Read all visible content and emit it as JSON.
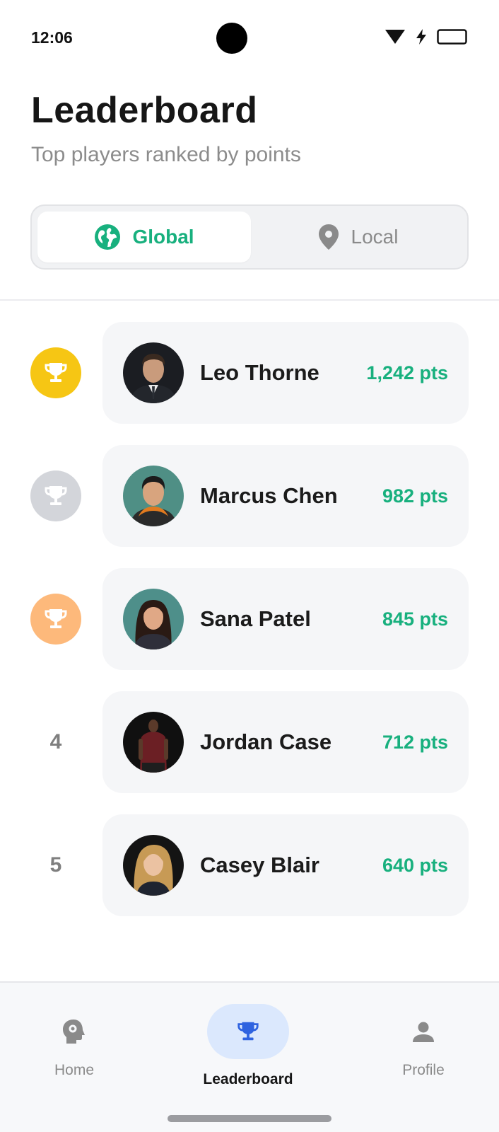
{
  "status_bar": {
    "time": "12:06"
  },
  "header": {
    "title": "Leaderboard",
    "subtitle": "Top players ranked by points"
  },
  "scope_toggle": {
    "options": [
      {
        "label": "Global",
        "icon": "globe-icon",
        "selected": true
      },
      {
        "label": "Local",
        "icon": "location-pin-icon",
        "selected": false
      }
    ]
  },
  "players": [
    {
      "rank": "1",
      "badge": "trophy-icon",
      "badge_color": "#f6c614",
      "name": "Leo Thorne",
      "points": "1,242 pts"
    },
    {
      "rank": "2",
      "badge": "trophy-icon",
      "badge_color": "#d3d5da",
      "name": "Marcus Chen",
      "points": "982 pts"
    },
    {
      "rank": "3",
      "badge": "trophy-icon",
      "badge_color": "#fdb97b",
      "name": "Sana Patel",
      "points": "845 pts"
    },
    {
      "rank": "4",
      "name": "Jordan Case",
      "points": "712 pts"
    },
    {
      "rank": "5",
      "name": "Casey Blair",
      "points": "640 pts"
    }
  ],
  "bottom_nav": {
    "items": [
      {
        "label": "Home",
        "icon": "brain-gear-icon",
        "active": false
      },
      {
        "label": "Leaderboard",
        "icon": "trophy-icon",
        "active": true
      },
      {
        "label": "Profile",
        "icon": "person-icon",
        "active": false
      }
    ]
  },
  "colors": {
    "accent_green": "#18b07e",
    "active_nav_blue": "#2f63e0",
    "gold": "#f6c614",
    "silver": "#d3d5da",
    "bronze": "#fdb97b"
  }
}
